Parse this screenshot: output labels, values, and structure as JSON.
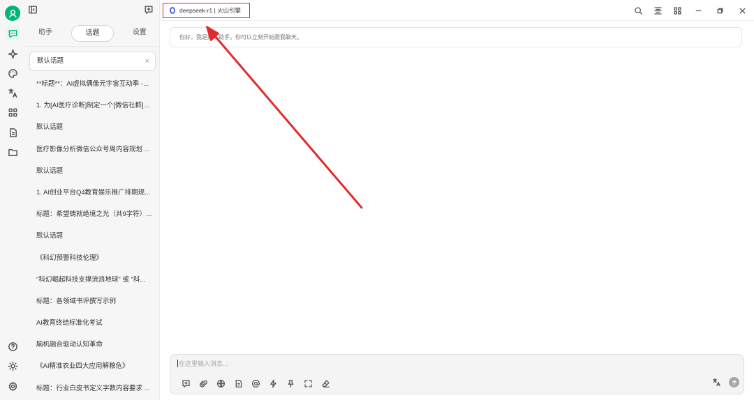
{
  "model_tab": {
    "label": "deepseek-r1 | 火山引擎"
  },
  "tabs": [
    {
      "label": "助手",
      "active": false
    },
    {
      "label": "话题",
      "active": true
    },
    {
      "label": "设置",
      "active": false
    }
  ],
  "topics": [
    "默认话题",
    "**标题**：AI虚拟偶像元宇宙互动季 -...",
    "1. 为[AI医疗诊断]制定一个[微信社群]...",
    "默认话题",
    "医疗影像分析微信公众号周内容规划 ...",
    "默认话题",
    "1. AI创业平台Q4教育娱乐推广排期规...",
    "标题：希望铸就绝境之光（共9字符）...",
    "默认话题",
    "《科幻预警科技伦理》",
    "\"科幻崛起科技支撑流浪地球\" 或 \"科...",
    "标题：各领域书评撰写示例",
    "AI教育终结标准化考试",
    "脑机融合驱动认知革命",
    "《AI精准农业四大应用解粮危》",
    "标题：行业白皮书定义字数内容要求 ..."
  ],
  "topic_close": "×",
  "chat": {
    "greeting": "你好，我是默认助手。你可以立刻开始跟我聊天。"
  },
  "composer": {
    "placeholder": "在这里输入消息..."
  },
  "colors": {
    "accent": "#00b578",
    "highlight_border": "#e02b2b",
    "annotation_arrow": "#e02b2b"
  }
}
